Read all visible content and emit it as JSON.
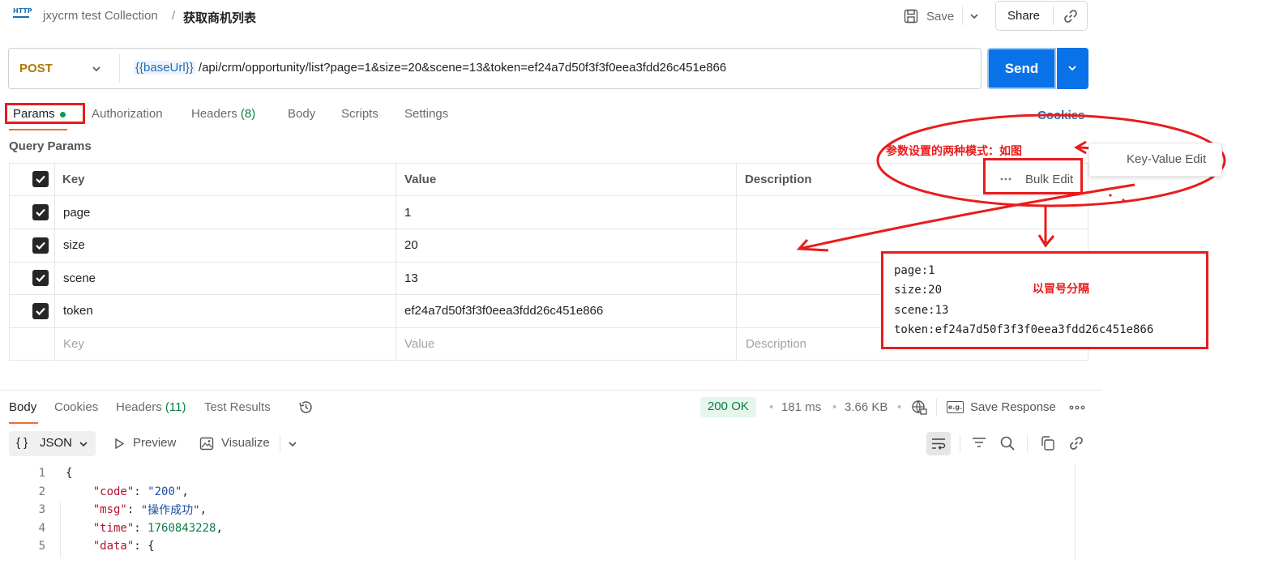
{
  "header": {
    "http_icon_text": "HTTP",
    "collection": "jxycrm test Collection",
    "separator": "/",
    "request_name": "获取商机列表",
    "save_label": "Save",
    "share_label": "Share"
  },
  "url_bar": {
    "method": "POST",
    "base_var": "{{baseUrl}}",
    "path": " /api/crm/opportunity/list?page=1&size=20&scene=13&token=ef24a7d50f3f3f0eea3fdd26c451e866",
    "send_label": "Send"
  },
  "request_tabs": {
    "params": "Params",
    "authorization": "Authorization",
    "headers": "Headers",
    "headers_count": "(8)",
    "body": "Body",
    "scripts": "Scripts",
    "settings": "Settings",
    "cookies": "Cookies"
  },
  "query_params": {
    "title": "Query Params",
    "columns": [
      "Key",
      "Value",
      "Description"
    ],
    "rows": [
      {
        "key": "page",
        "value": "1",
        "checked": true
      },
      {
        "key": "size",
        "value": "20",
        "checked": true
      },
      {
        "key": "scene",
        "value": "13",
        "checked": true
      },
      {
        "key": "token",
        "value": "ef24a7d50f3f3f0eea3fdd26c451e866",
        "checked": true
      }
    ],
    "placeholder_row": {
      "key": "Key",
      "value": "Value",
      "description": "Description"
    },
    "bulk_edit_label": "Bulk Edit"
  },
  "annotation": {
    "note_modes": "参数设置的两种模式：如图",
    "key_value_edit": "Key-Value Edit",
    "bulk_lines": [
      "page:1",
      "size:20",
      "scene:13",
      "token:ef24a7d50f3f3f0eea3fdd26c451e866"
    ],
    "note_colon": "以冒号分隔",
    "accent_color": "#e81c1c"
  },
  "response_tabs": {
    "body": "Body",
    "cookies": "Cookies",
    "headers": "Headers",
    "headers_count": "(11)",
    "test_results": "Test Results",
    "status": "200 OK",
    "time": "181 ms",
    "size": "3.66 KB",
    "save_response": "Save Response"
  },
  "body_toolbar": {
    "format": "JSON",
    "format_icon": "{ }",
    "preview": "Preview",
    "visualize": "Visualize"
  },
  "code_lines": [
    {
      "n": "1",
      "parts": [
        {
          "t": "{",
          "c": "p"
        }
      ]
    },
    {
      "n": "2",
      "parts": [
        {
          "t": "    ",
          "c": "p"
        },
        {
          "t": "\"code\"",
          "c": "k"
        },
        {
          "t": ": ",
          "c": "p"
        },
        {
          "t": "\"200\"",
          "c": "s"
        },
        {
          "t": ",",
          "c": "p"
        }
      ]
    },
    {
      "n": "3",
      "parts": [
        {
          "t": "    ",
          "c": "p"
        },
        {
          "t": "\"msg\"",
          "c": "k"
        },
        {
          "t": ": ",
          "c": "p"
        },
        {
          "t": "\"操作成功\"",
          "c": "s"
        },
        {
          "t": ",",
          "c": "p"
        }
      ]
    },
    {
      "n": "4",
      "parts": [
        {
          "t": "    ",
          "c": "p"
        },
        {
          "t": "\"time\"",
          "c": "k"
        },
        {
          "t": ": ",
          "c": "p"
        },
        {
          "t": "1760843228",
          "c": "n"
        },
        {
          "t": ",",
          "c": "p"
        }
      ]
    },
    {
      "n": "5",
      "parts": [
        {
          "t": "    ",
          "c": "p"
        },
        {
          "t": "\"data\"",
          "c": "k"
        },
        {
          "t": ": {",
          "c": "p"
        }
      ]
    }
  ]
}
